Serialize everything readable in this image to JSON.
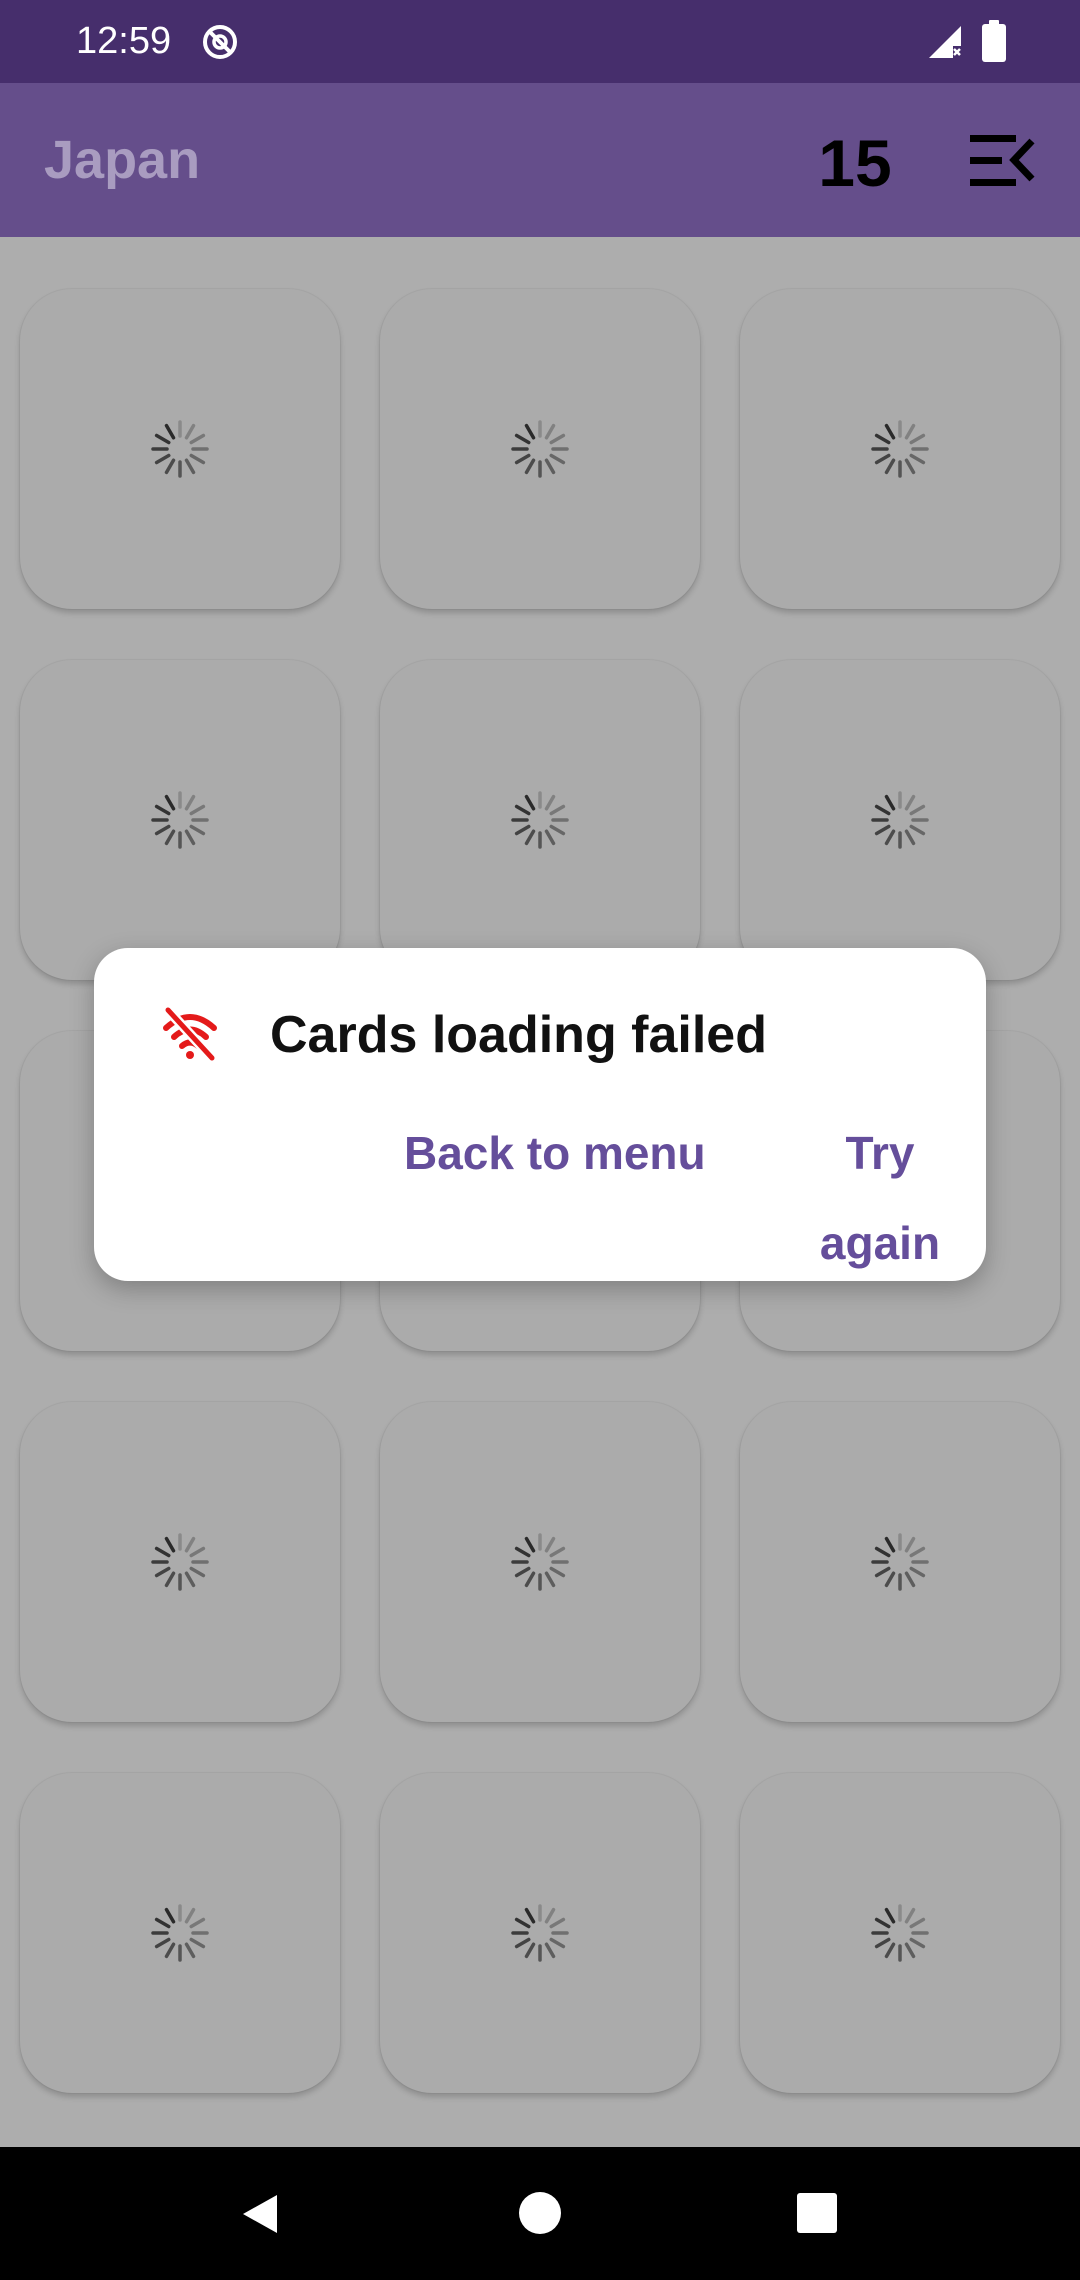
{
  "status_bar": {
    "time": "12:59",
    "icons": [
      "assistant-icon",
      "signal-no-data-icon",
      "battery-icon"
    ]
  },
  "app_bar": {
    "title": "Japan",
    "score": "15",
    "menu_icon": "menu-collapse-icon"
  },
  "grid": {
    "rows": 5,
    "columns": 3,
    "card_state": "loading",
    "spinner_icon": "loading-spinner-icon"
  },
  "dialog": {
    "icon": "wifi-off-icon",
    "title": "Cards loading failed",
    "back_label": "Back to menu",
    "retry_label": "Try again"
  },
  "nav_bar": {
    "icons": [
      "back-icon",
      "home-icon",
      "recents-icon"
    ]
  },
  "colors": {
    "status_bar": "#462e6c",
    "app_bar": "#654e8b",
    "accent": "#654e9b",
    "error": "#e41a1a",
    "scrim_background": "#adadad"
  }
}
